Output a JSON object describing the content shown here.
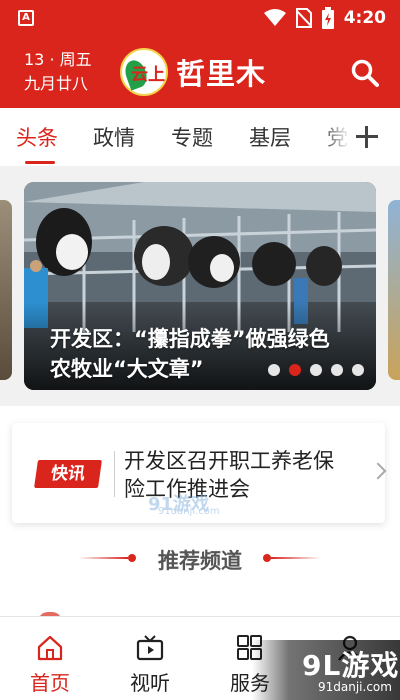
{
  "status_bar": {
    "time": "4:20",
    "notification_icon": "app-a-icon",
    "colors": {
      "background": "#d9251c"
    }
  },
  "header": {
    "date_line1": "13 · 周五",
    "date_line2": "九月廿八",
    "logo_badge": "云上",
    "logo_text": "哲里木",
    "search_icon": "search-icon"
  },
  "tabs": {
    "items": [
      "头条",
      "政情",
      "专题",
      "基层",
      "党"
    ],
    "active": "头条",
    "add_icon": "plus-icon"
  },
  "banner": {
    "caption": "开发区：“攥指成拳”做强绿色农牧业“大文章”",
    "page_count": 5,
    "active_page": 2
  },
  "news_flash": {
    "badge": "快讯",
    "title": "开发区召开职工养老保险工作推进会"
  },
  "recommended": {
    "title": "推荐频道"
  },
  "bottom_nav": {
    "items": [
      {
        "label": "首页",
        "icon": "home-icon",
        "active": true
      },
      {
        "label": "视听",
        "icon": "tv-play-icon",
        "active": false
      },
      {
        "label": "服务",
        "icon": "grid-icon",
        "active": false
      },
      {
        "label": "",
        "icon": "user-icon",
        "active": false
      }
    ]
  },
  "watermarks": {
    "small_text": "91游戏",
    "small_url": "91danji.com",
    "corner_brand": "9L游戏",
    "corner_url": "91danji.com"
  },
  "colors": {
    "brand_red": "#d9251c",
    "background_gray": "#f1f1f1"
  }
}
